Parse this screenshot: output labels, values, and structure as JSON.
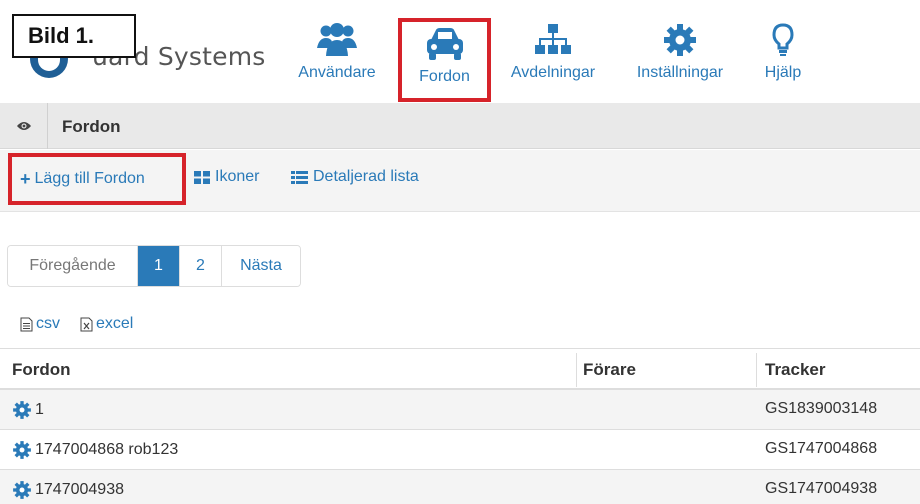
{
  "header": {
    "bild_label": "Bild 1.",
    "logo_text": "uard Systems",
    "logo_text_partial": "ɢuard Systems",
    "nav": [
      {
        "label": "Användare",
        "icon": "users-icon"
      },
      {
        "label": "Fordon",
        "icon": "car-icon",
        "highlighted": true
      },
      {
        "label": "Avdelningar",
        "icon": "sitemap-icon"
      },
      {
        "label": "Inställningar",
        "icon": "gear-icon"
      },
      {
        "label": "Hjälp",
        "icon": "lightbulb-icon"
      }
    ]
  },
  "section": {
    "title": "Fordon",
    "icon": "eye-icon"
  },
  "toolbar": {
    "add_label": "Lägg till Fordon",
    "ikoner_label": "Ikoner",
    "lista_label": "Detaljerad lista"
  },
  "pagination": {
    "prev": "Föregående",
    "pages": [
      "1",
      "2"
    ],
    "active": "1",
    "next": "Nästa"
  },
  "exports": {
    "csv": "csv",
    "excel": "excel"
  },
  "table": {
    "headers": {
      "fordon": "Fordon",
      "forare": "Förare",
      "tracker": "Tracker"
    },
    "rows": [
      {
        "fordon": "1",
        "forare": "",
        "tracker": "GS1839003148"
      },
      {
        "fordon": "1747004868 rob123",
        "forare": "",
        "tracker": "GS1747004868"
      },
      {
        "fordon": "1747004938",
        "forare": "",
        "tracker": "GS1747004938"
      }
    ]
  },
  "colors": {
    "accent": "#2a7ab8",
    "highlight": "#d6232a",
    "bar": "#e9e9e9"
  }
}
